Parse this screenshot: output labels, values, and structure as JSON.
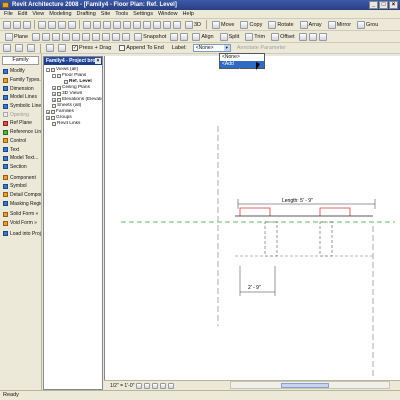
{
  "window": {
    "title": "Revit Architecture 2008 - [Family4 - Floor Plan: Ref. Level]"
  },
  "menu": [
    "File",
    "Edit",
    "View",
    "Modeling",
    "Drafting",
    "Site",
    "Tools",
    "Settings",
    "Window",
    "Help"
  ],
  "toolbar1": {
    "labels": [
      "3D",
      "Move",
      "Copy",
      "Rotate",
      "Array",
      "Mirror",
      "Grou"
    ]
  },
  "toolbar2": {
    "labels": [
      "Plane",
      "Snapshot",
      "Align",
      "Split",
      "Trim",
      "Offset"
    ]
  },
  "options_bar": {
    "press_drag": "Press + Drag",
    "append_to_end": "Append To End",
    "label_caption": "Label:",
    "label_value": "<None>",
    "annotation_parameter": "Annotate Parameter"
  },
  "label_dropdown": {
    "options": [
      "<None>",
      "<Add parameter...>"
    ],
    "selected_index": 1
  },
  "design_bar": {
    "tab": "Family",
    "tools": [
      {
        "label": "Modify",
        "disabled": false
      },
      {
        "label": "Family Types...",
        "disabled": false
      },
      {
        "label": "Dimension",
        "disabled": false
      },
      {
        "label": "Model Lines",
        "disabled": false
      },
      {
        "label": "Symbolic Lines",
        "disabled": false
      },
      {
        "label": "Opening",
        "disabled": true
      },
      {
        "label": "Ref Plane",
        "disabled": false
      },
      {
        "label": "Reference Line",
        "disabled": false
      },
      {
        "label": "Control",
        "disabled": false
      },
      {
        "label": "Text",
        "disabled": false
      },
      {
        "label": "Model Text...",
        "disabled": false
      },
      {
        "label": "Section",
        "disabled": false
      },
      {
        "label": "Component",
        "disabled": false
      },
      {
        "label": "Symbol",
        "disabled": false
      },
      {
        "label": "Detail Component",
        "disabled": false
      },
      {
        "label": "Masking Region",
        "disabled": false
      },
      {
        "label": "Solid Form »",
        "disabled": false
      },
      {
        "label": "Void Form »",
        "disabled": false
      },
      {
        "label": "Load into Project",
        "disabled": false
      }
    ]
  },
  "project_browser": {
    "title": "Family4 - Project bro...",
    "nodes": [
      {
        "label": "Views (all)",
        "depth": 0,
        "expander": "-",
        "bold": false
      },
      {
        "label": "Floor Plans",
        "depth": 1,
        "expander": "-",
        "bold": false
      },
      {
        "label": "Ref. Level",
        "depth": 2,
        "expander": "",
        "bold": true
      },
      {
        "label": "Ceiling Plans",
        "depth": 1,
        "expander": "+",
        "bold": false
      },
      {
        "label": "3D Views",
        "depth": 1,
        "expander": "+",
        "bold": false
      },
      {
        "label": "Elevations (Elevatio",
        "depth": 1,
        "expander": "+",
        "bold": false
      },
      {
        "label": "Sheets (all)",
        "depth": 0,
        "expander": "",
        "bold": false
      },
      {
        "label": "Families",
        "depth": 0,
        "expander": "+",
        "bold": false
      },
      {
        "label": "Groups",
        "depth": 0,
        "expander": "+",
        "bold": false
      },
      {
        "label": "Revit Links",
        "depth": 0,
        "expander": "",
        "bold": false
      }
    ]
  },
  "drawing": {
    "dim_upper": "Length: 5' - 9\"",
    "dim_lower": "2' - 9\""
  },
  "view_control": {
    "scale": "1/2\" = 1'-0\""
  },
  "status": {
    "text": "Ready"
  }
}
